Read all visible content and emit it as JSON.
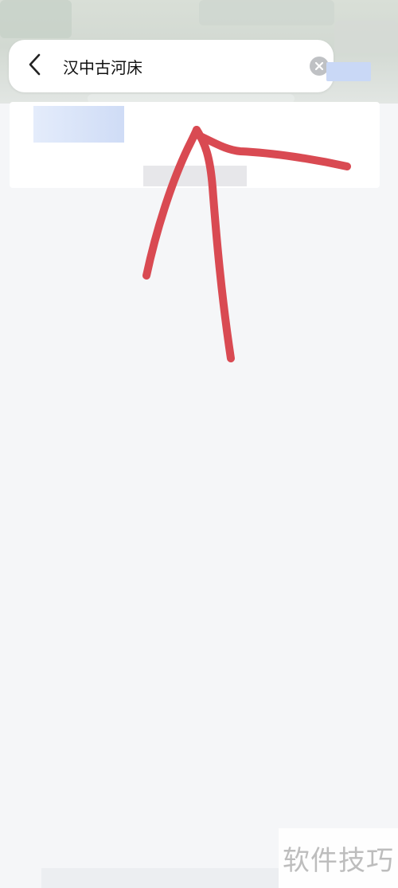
{
  "search": {
    "query": "汉中古河床"
  },
  "icons": {
    "back": "back-arrow-icon",
    "clear": "clear-icon"
  },
  "annotation": {
    "color": "#d94a52",
    "shape": "hand-drawn-arrow"
  },
  "watermark": {
    "text": "软件技巧"
  }
}
